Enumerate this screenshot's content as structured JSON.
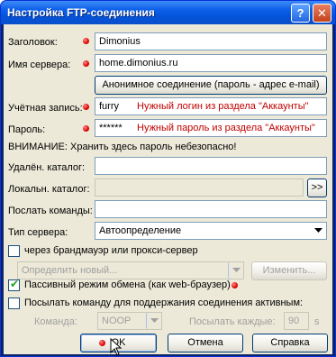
{
  "window": {
    "title": "Настройка FTP-соединения"
  },
  "form": {
    "header_label": "Заголовок:",
    "header_value": "Dimonius",
    "server_label": "Имя сервера:",
    "server_value": "home.dimonius.ru",
    "anon_button": "Анонимное соединение (пароль - адрес e-mail)",
    "account_label": "Учётная запись:",
    "account_value": "furry",
    "account_hint": "Нужный логин из раздела \"Аккаунты\"",
    "password_label": "Пароль:",
    "password_value": "******",
    "password_hint": "Нужный пароль из раздела \"Аккаунты\"",
    "warning": "ВНИМАНИЕ: Хранить здесь пароль небезопасно!",
    "remote_dir_label": "Удалён. каталог:",
    "remote_dir_value": "",
    "local_dir_label": "Локальн. каталог:",
    "local_dir_value": "",
    "browse_button": ">>",
    "send_cmd_label": "Послать команды:",
    "send_cmd_value": "",
    "server_type_label": "Тип сервера:",
    "server_type_value": "Автоопределение",
    "firewall_checkbox": "через брандмауэр или прокси-сервер",
    "firewall_checked": false,
    "proxy_select": "Определить новый...",
    "change_button": "Изменить...",
    "passive_checkbox": "Пассивный режим обмена (как web-браузер)",
    "passive_checked": true,
    "keepalive_checkbox": "Посылать команду для поддержания соединения активным:",
    "keepalive_checked": false,
    "command_label": "Команда:",
    "command_value": "NOOP",
    "interval_label": "Посылать каждые:",
    "interval_value": "90",
    "interval_unit": "s"
  },
  "buttons": {
    "ok": "OK",
    "cancel": "Отмена",
    "help": "Справка"
  },
  "colors": {
    "hint": "#c00000",
    "dot": "#e00000",
    "titlebar": "#0a5ee8"
  }
}
